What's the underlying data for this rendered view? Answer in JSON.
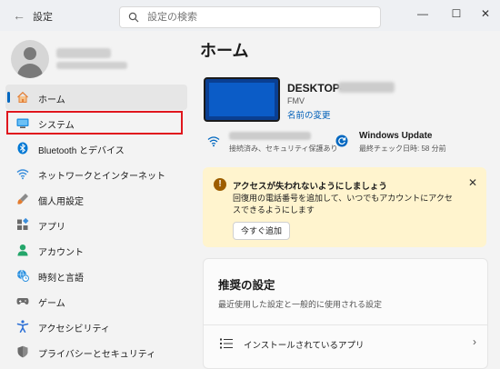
{
  "app": {
    "title": "設定",
    "search_placeholder": "設定の検索"
  },
  "window_controls": {
    "minimize": "—",
    "maximize": "☐",
    "close": "✕"
  },
  "sidebar": {
    "items": [
      {
        "label": "ホーム",
        "icon": "home-icon",
        "active": true
      },
      {
        "label": "システム",
        "icon": "system-display-icon",
        "highlighted": true
      },
      {
        "label": "Bluetooth とデバイス",
        "icon": "bluetooth-icon"
      },
      {
        "label": "ネットワークとインターネット",
        "icon": "wifi-icon"
      },
      {
        "label": "個人用設定",
        "icon": "paintbrush-icon"
      },
      {
        "label": "アプリ",
        "icon": "apps-icon"
      },
      {
        "label": "アカウント",
        "icon": "account-icon"
      },
      {
        "label": "時刻と言語",
        "icon": "globe-clock-icon"
      },
      {
        "label": "ゲーム",
        "icon": "gamepad-icon"
      },
      {
        "label": "アクセシビリティ",
        "icon": "accessibility-icon"
      },
      {
        "label": "プライバシーとセキュリティ",
        "icon": "shield-icon"
      }
    ]
  },
  "main": {
    "title": "ホーム",
    "device": {
      "name": "DESKTOP-",
      "model": "FMV",
      "rename_link": "名前の変更"
    },
    "network": {
      "status": "接続済み、セキュリティ保護あり"
    },
    "windows_update": {
      "title": "Windows Update",
      "subtitle": "最終チェック日時: 58 分前"
    },
    "alert": {
      "title": "アクセスが失われないようにしましょう",
      "body": "回復用の電話番号を追加して、いつでもアカウントにアクセスできるようにします",
      "button": "今すぐ追加",
      "icon": "!",
      "close": "✕"
    },
    "recommended": {
      "title": "推奨の設定",
      "subtitle": "最近使用した設定と一般的に使用される設定",
      "items": [
        {
          "label": "インストールされているアプリ",
          "chevron": "›"
        }
      ]
    }
  },
  "colors": {
    "accent": "#0067c0",
    "highlight_box": "#e0161d",
    "alert_bg": "#fff4ce"
  }
}
